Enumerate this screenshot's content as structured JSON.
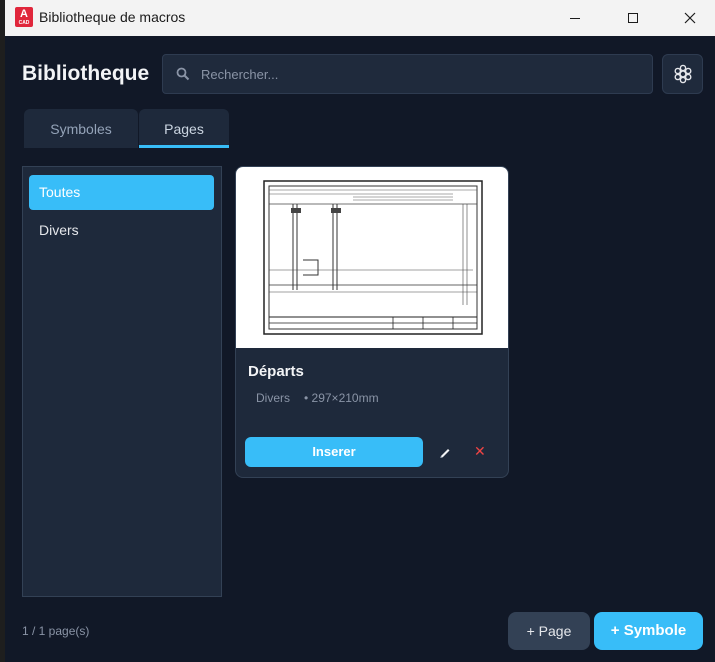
{
  "window": {
    "title": "Bibliotheque de macros",
    "app_icon_letter": "A",
    "app_icon_sub": "CAD",
    "controls": [
      "minimize",
      "maximize",
      "close"
    ]
  },
  "header": {
    "title": "Bibliotheque",
    "search_placeholder": "Rechercher...",
    "settings_icon": "gear-icon"
  },
  "tabs": [
    {
      "label": "Symboles",
      "active": false
    },
    {
      "label": "Pages",
      "active": true
    }
  ],
  "categories": [
    {
      "label": "Toutes",
      "selected": true
    },
    {
      "label": "Divers",
      "selected": false
    }
  ],
  "cards": [
    {
      "title": "Départs",
      "category": "Divers",
      "size": "• 297×210mm",
      "insert_label": "Inserer",
      "edit_icon": "pencil-icon",
      "delete_icon": "close-icon",
      "delete_glyph": "✕"
    }
  ],
  "footer": {
    "page_count": "1 / 1 page(s)",
    "add_page_label": "+ Page",
    "add_symbol_label": "+ Symbole"
  },
  "colors": {
    "accent": "#38bdf8",
    "background": "#111827",
    "panel": "#1e293b",
    "danger": "#ef4444"
  }
}
